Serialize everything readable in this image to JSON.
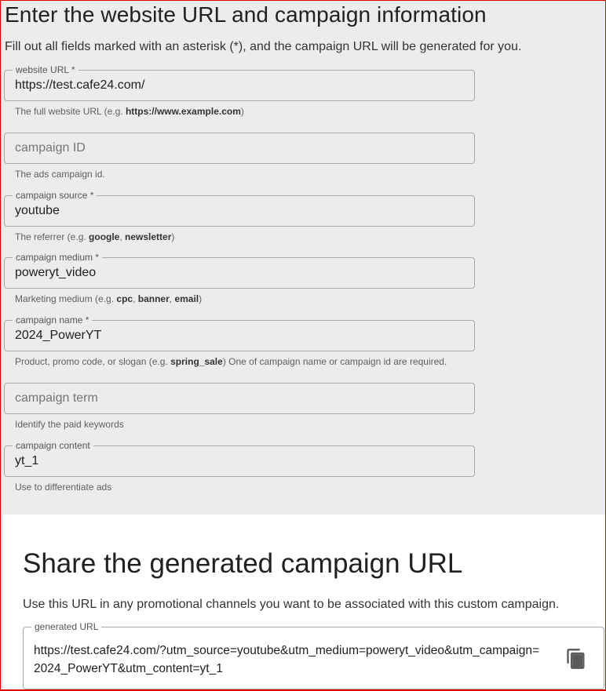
{
  "form": {
    "title": "Enter the website URL and campaign information",
    "description": "Fill out all fields marked with an asterisk (*), and the campaign URL will be generated for you.",
    "website_url": {
      "label": "website URL *",
      "value": "https://test.cafe24.com/",
      "helper_prefix": "The full website URL (e.g. ",
      "helper_bold": "https://www.example.com",
      "helper_suffix": ")"
    },
    "campaign_id": {
      "placeholder": "campaign ID",
      "helper": "The ads campaign id."
    },
    "campaign_source": {
      "label": "campaign source *",
      "value": "youtube",
      "helper_prefix": "The referrer (e.g. ",
      "helper_bold1": "google",
      "helper_sep": ", ",
      "helper_bold2": "newsletter",
      "helper_suffix": ")"
    },
    "campaign_medium": {
      "label": "campaign medium *",
      "value": "poweryt_video",
      "helper_prefix": "Marketing medium (e.g. ",
      "helper_bold1": "cpc",
      "helper_sep1": ", ",
      "helper_bold2": "banner",
      "helper_sep2": ", ",
      "helper_bold3": "email",
      "helper_suffix": ")"
    },
    "campaign_name": {
      "label": "campaign name *",
      "value": "2024_PowerYT",
      "helper_prefix": "Product, promo code, or slogan (e.g. ",
      "helper_bold": "spring_sale",
      "helper_suffix": ") One of campaign name or campaign id are required."
    },
    "campaign_term": {
      "placeholder": "campaign term",
      "helper": "Identify the paid keywords"
    },
    "campaign_content": {
      "label": "campaign content",
      "value": "yt_1",
      "helper": "Use to differentiate ads"
    }
  },
  "share": {
    "title": "Share the generated campaign URL",
    "description": "Use this URL in any promotional channels you want to be associated with this custom campaign.",
    "label": "generated URL",
    "url_line1": "https://test.cafe24.com/?utm_source=youtube&utm_medium=poweryt_video&utm_campaign=",
    "url_line2": "2024_PowerYT&utm_content=yt_1",
    "copy_icon": "copy-icon"
  }
}
